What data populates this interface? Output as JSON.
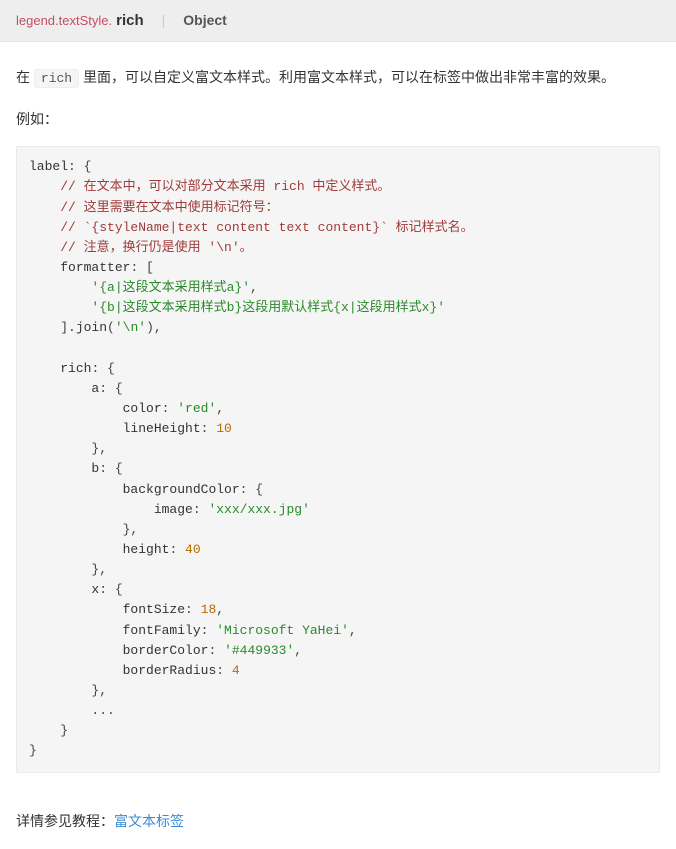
{
  "header": {
    "prefix": "legend.textStyle.",
    "name": "rich",
    "divider": "|",
    "type": "Object"
  },
  "intro": {
    "t1": "在 ",
    "code": "rich",
    "t2": " 里面，可以自定义富文本样式。利用富文本样式，可以在标签中做出非常丰富的效果。"
  },
  "example_label": "例如：",
  "code": {
    "l1_key": "label",
    "l1_punc": ": {",
    "c1": "// 在文本中，可以对部分文本采用 rich 中定义样式。",
    "c2": "// 这里需要在文本中使用标记符号：",
    "c3": "// `{styleName|text content text content}` 标记样式名。",
    "c4": "// 注意，换行仍是使用 '\\n'。",
    "fmt_key": "formatter",
    "fmt_punc": ": [",
    "s1": "'{a|这段文本采用样式a}'",
    "comma": ",",
    "s2": "'{b|这段文本采用样式b}这段用默认样式{x|这段用样式x}'",
    "join_b1": "].",
    "join_key": "join",
    "join_b2": "(",
    "join_arg": "'\\n'",
    "join_b3": "),",
    "rich_key": "rich",
    "rich_punc": ": {",
    "a_key": "a",
    "a_punc": ": {",
    "color_key": "color",
    "color_punc": ": ",
    "color_val": "'red'",
    "lh_key": "lineHeight",
    "lh_punc": ": ",
    "lh_val": "10",
    "close_comma": "},",
    "b_key": "b",
    "b_punc": ": {",
    "bg_key": "backgroundColor",
    "bg_punc": ": {",
    "img_key": "image",
    "img_punc": ": ",
    "img_val": "'xxx/xxx.jpg'",
    "h_key": "height",
    "h_punc": ": ",
    "h_val": "40",
    "x_key": "x",
    "x_punc": ": {",
    "fs_key": "fontSize",
    "fs_punc": ": ",
    "fs_val": "18",
    "ff_key": "fontFamily",
    "ff_punc": ": ",
    "ff_val": "'Microsoft YaHei'",
    "bc_key": "borderColor",
    "bc_punc": ": ",
    "bc_val": "'#449933'",
    "br_key": "borderRadius",
    "br_punc": ": ",
    "br_val": "4",
    "ellipsis": "...",
    "close": "}"
  },
  "footer": {
    "t1": "详情参见教程：",
    "link": "富文本标签"
  }
}
